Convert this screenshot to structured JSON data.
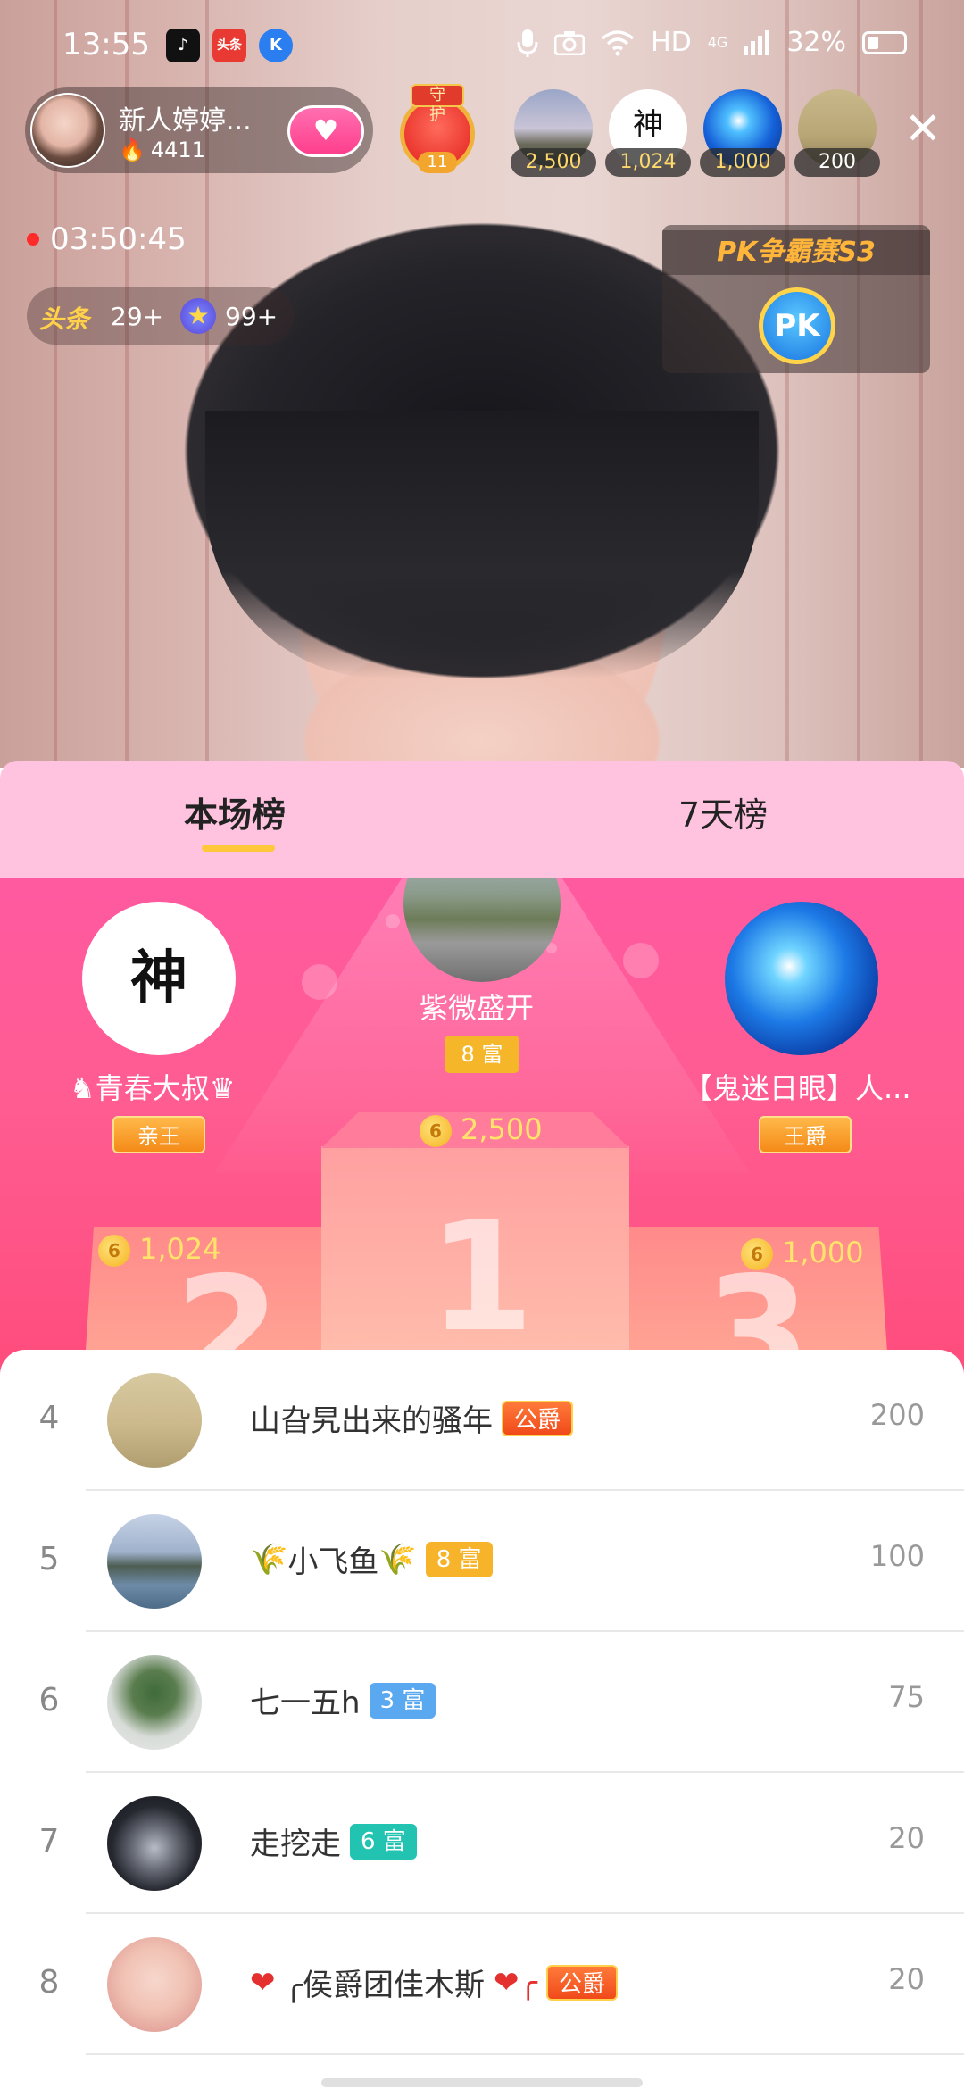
{
  "status_bar": {
    "time": "13:55",
    "network": "HD",
    "cell": "4G",
    "battery": "32%",
    "icons": [
      "tiktok-icon",
      "toutiao-icon",
      "k-app-icon",
      "mic-icon",
      "camera-icon",
      "wifi-icon",
      "signal-icon",
      "battery-icon"
    ]
  },
  "host": {
    "name": "新人婷婷...",
    "fans": "4411",
    "guard_tag": "守护",
    "guard_count": "11"
  },
  "top_viewers": [
    {
      "count": "2,500"
    },
    {
      "count": "1,024",
      "char": "神"
    },
    {
      "count": "1,000"
    },
    {
      "count": "200"
    }
  ],
  "live_duration": "03:50:45",
  "ranks": {
    "toutiao_label": "头条",
    "toutiao_value": "29+",
    "star_value": "99+"
  },
  "pk": {
    "title": "PK争霸赛S3",
    "button": "PK"
  },
  "tabs": [
    {
      "label": "本场榜"
    },
    {
      "label": "7天榜"
    }
  ],
  "podium": {
    "first": {
      "name": "紫微盛开",
      "badge": "8 富",
      "score": "2,500",
      "place": "1"
    },
    "second": {
      "name": "♞青春大叔♛",
      "badge": "亲王",
      "score": "1,024",
      "place": "2",
      "char": "神"
    },
    "third": {
      "name": "【鬼迷日眼】人...",
      "badge": "王爵",
      "score": "1,000",
      "place": "3"
    }
  },
  "list": [
    {
      "rank": "4",
      "name": "山旮旯出来的骚年",
      "tag": "公爵",
      "score": "200"
    },
    {
      "rank": "5",
      "name_prefix": "🌾",
      "name": "小飞鱼",
      "name_suffix": "🌾",
      "tag": "8 富",
      "score": "100"
    },
    {
      "rank": "6",
      "name": "七一五h",
      "tag": "3 富",
      "score": "75"
    },
    {
      "rank": "7",
      "name": "走挖走",
      "tag": "6 富",
      "score": "20"
    },
    {
      "rank": "8",
      "name_prefix": "❤",
      "name": "╭侯爵团佳木斯",
      "name_suffix": "❤╭",
      "tag": "公爵",
      "score": "20"
    }
  ],
  "colors": {
    "tab_bg": "#ffc3e0",
    "podium_pink": "#ff5aa0",
    "accent_gold": "#ffc83c"
  }
}
